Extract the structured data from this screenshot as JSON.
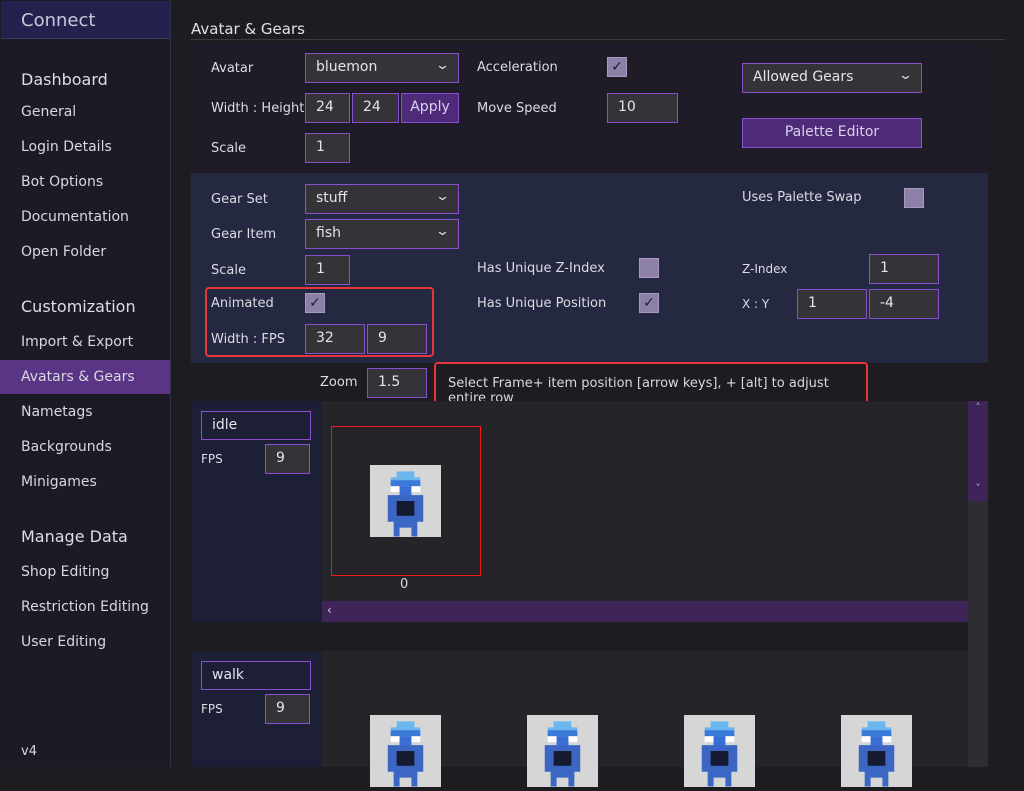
{
  "sidebar": {
    "connect": "Connect",
    "sections": [
      {
        "title": "Dashboard",
        "items": [
          "General",
          "Login Details",
          "Bot Options",
          "Documentation",
          "Open Folder"
        ]
      },
      {
        "title": "Customization",
        "items": [
          "Import & Export",
          "Avatars & Gears",
          "Nametags",
          "Backgrounds",
          "Minigames"
        ]
      },
      {
        "title": "Manage Data",
        "items": [
          "Shop Editing",
          "Restriction Editing",
          "User Editing"
        ]
      }
    ],
    "selected": "Avatars & Gears",
    "version": "v4"
  },
  "page_title": "Avatar & Gears",
  "avatar": {
    "avatar_label": "Avatar",
    "avatar_value": "bluemon",
    "wh_label": "Width : Height",
    "width": "24",
    "height": "24",
    "apply": "Apply",
    "scale_label": "Scale",
    "scale": "1",
    "accel_label": "Acceleration",
    "accel_checked": true,
    "speed_label": "Move Speed",
    "speed": "10",
    "allowed_gears": "Allowed Gears",
    "palette_editor": "Palette Editor"
  },
  "gear": {
    "set_label": "Gear Set",
    "set_value": "stuff",
    "item_label": "Gear Item",
    "item_value": "fish",
    "scale_label": "Scale",
    "scale": "1",
    "animated_label": "Animated",
    "animated_checked": true,
    "wfps_label": "Width : FPS",
    "width": "32",
    "fps": "9",
    "uz_label": "Has Unique Z-Index",
    "uz_checked": false,
    "upos_label": "Has Unique Position",
    "upos_checked": true,
    "palette_label": "Uses Palette Swap",
    "palette_checked": false,
    "z_label": "Z-Index",
    "z": "1",
    "xy_label": "X : Y",
    "x": "1",
    "y": "-4"
  },
  "zoom": {
    "label": "Zoom",
    "value": "1.5",
    "hint": "Select Frame+ item position [arrow keys], + [alt] to adjust entire row"
  },
  "animations": [
    {
      "name": "idle",
      "fps_label": "FPS",
      "fps": "9",
      "frames": [
        "0"
      ]
    },
    {
      "name": "walk",
      "fps_label": "FPS",
      "fps": "9",
      "frames": [
        "",
        "",
        "",
        ""
      ]
    }
  ],
  "colors": {
    "accent": "#8a4fcf",
    "selected": "#5b3585",
    "highlight": "#e8353c"
  }
}
